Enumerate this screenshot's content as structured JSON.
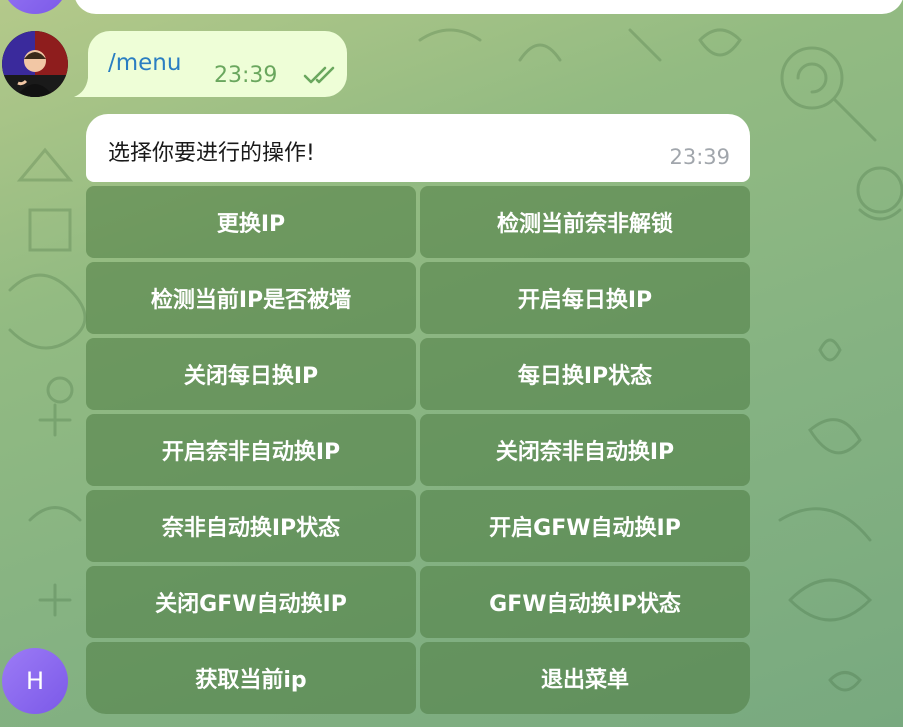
{
  "colors": {
    "outgoing_bubble": "#eefed7",
    "incoming_bubble": "#ffffff",
    "command_text": "#2a7ec2",
    "outgoing_time": "#6aa75e",
    "incoming_time": "#a1a6ac",
    "keyboard_button": "#4a7840",
    "bot_avatar": "#8a67f0"
  },
  "outgoing_message": {
    "text": "/menu",
    "time": "23:39",
    "status_icon": "double-check-icon"
  },
  "incoming_message": {
    "text": "选择你要进行的操作!",
    "time": "23:39"
  },
  "bot_avatar": {
    "initial": "H"
  },
  "keyboard": {
    "buttons": [
      "更换IP",
      "检测当前奈非解锁",
      "检测当前IP是否被墙",
      "开启每日换IP",
      "关闭每日换IP",
      "每日换IP状态",
      "开启奈非自动换IP",
      "关闭奈非自动换IP",
      "奈非自动换IP状态",
      "开启GFW自动换IP",
      "关闭GFW自动换IP",
      "GFW自动换IP状态",
      "获取当前ip",
      "退出菜单"
    ]
  }
}
